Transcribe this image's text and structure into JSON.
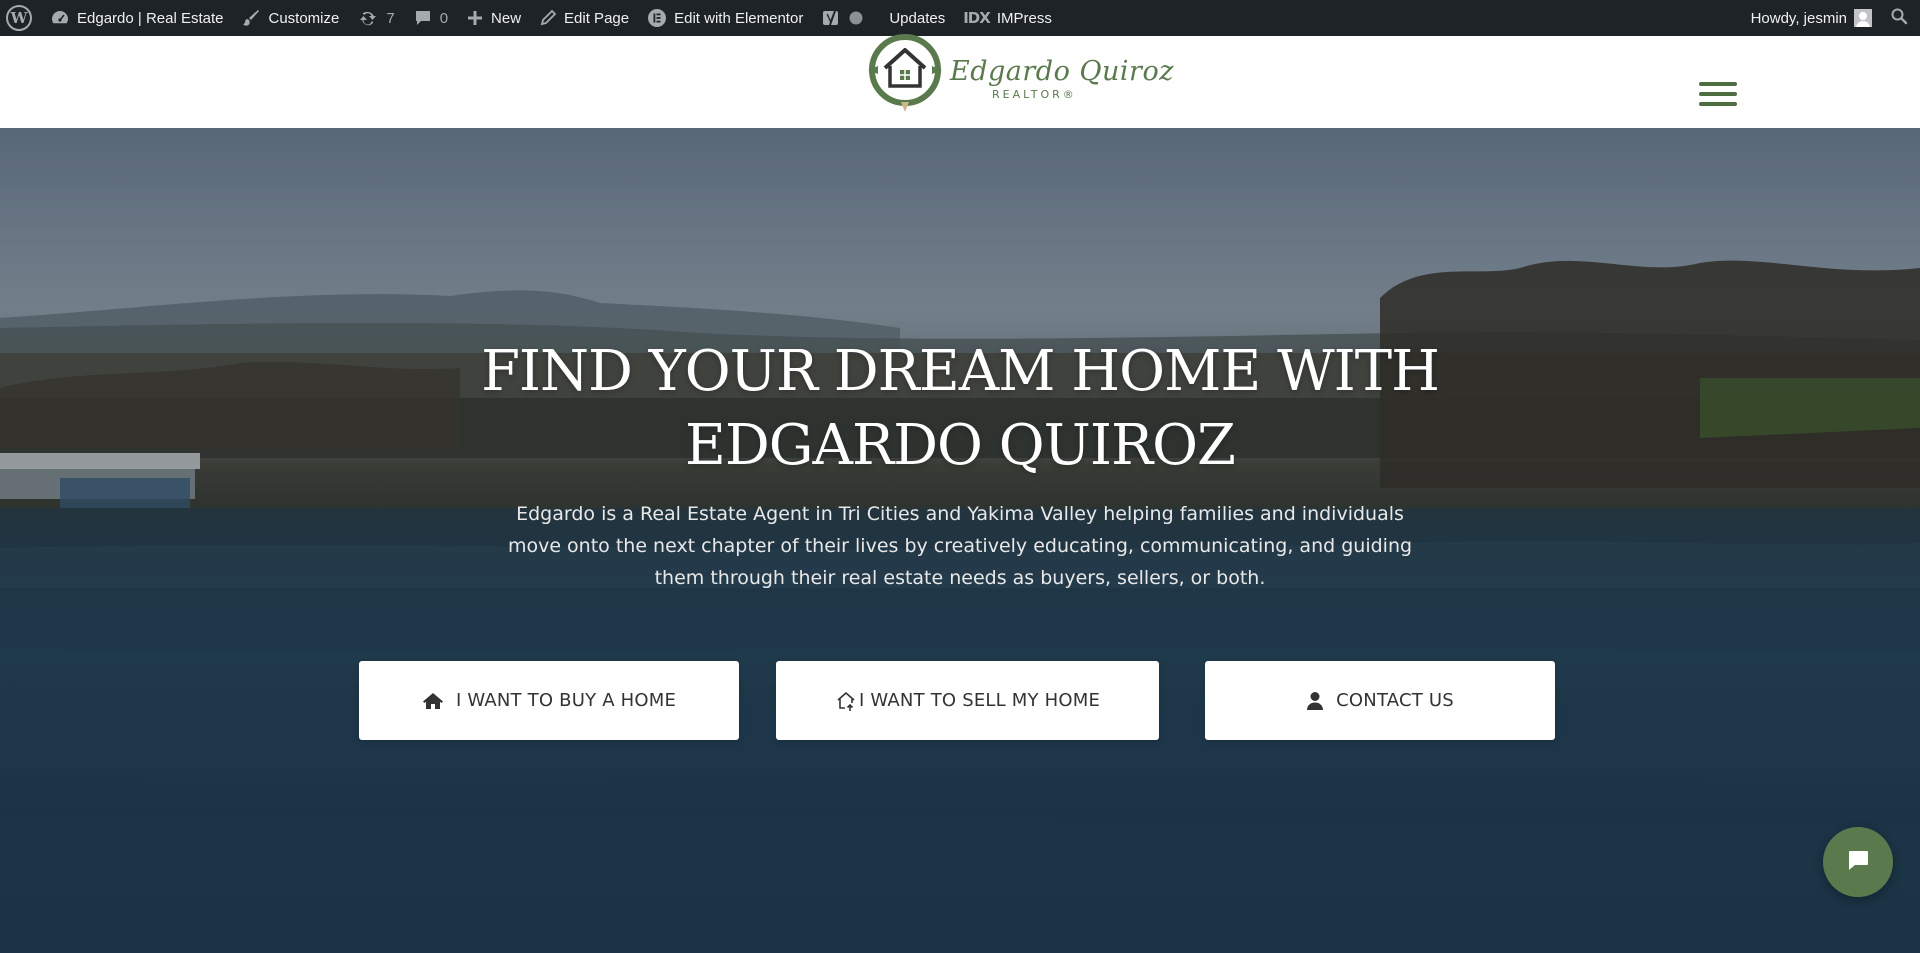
{
  "admin_bar": {
    "site_name": "Edgardo | Real Estate",
    "customize": "Customize",
    "updates_count": "7",
    "comments_count": "0",
    "new": "New",
    "edit_page": "Edit Page",
    "edit_with_elementor": "Edit with Elementor",
    "updates": "Updates",
    "impress": "IMPress",
    "greeting": "Howdy, jesmin"
  },
  "header": {
    "logo_name": "Edgardo Quiroz",
    "logo_sub": "REALTOR®"
  },
  "hero": {
    "title_line1": "Find your dream home with",
    "title_line2": "Edgardo Quiroz",
    "description": "Edgardo is a Real Estate Agent in Tri Cities and Yakima Valley helping families and individuals move onto the next chapter of their lives by creatively educating, communicating, and guiding them through their real estate needs as buyers, sellers, or both.",
    "buttons": [
      {
        "label": "I WANT TO BUY A HOME",
        "icon": "home-icon"
      },
      {
        "label": "I WANT TO SELL MY HOME",
        "icon": "house-upload-icon"
      },
      {
        "label": "CONTACT US",
        "icon": "user-icon"
      }
    ]
  },
  "colors": {
    "brand_green": "#5a7a4e",
    "admin_bar_bg": "#1d2327"
  }
}
